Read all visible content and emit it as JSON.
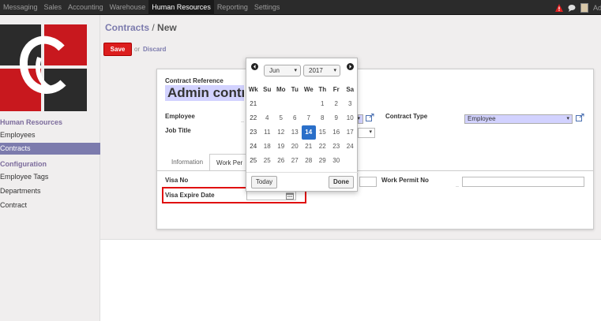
{
  "topbar": {
    "menu": [
      "Messaging",
      "Sales",
      "Accounting",
      "Warehouse",
      "Human Resources",
      "Reporting",
      "Settings"
    ],
    "active_index": 4,
    "user_name": "Adm"
  },
  "sidebar": {
    "sections": [
      {
        "title": "Human Resources",
        "items": [
          "Employees",
          "Contracts"
        ]
      },
      {
        "title": "Configuration",
        "items": [
          "Employee Tags",
          "Departments",
          "Contract"
        ]
      }
    ],
    "active_item": "Contracts"
  },
  "breadcrumb": {
    "parent": "Contracts",
    "separator": "/",
    "current": "New"
  },
  "actions": {
    "save": "Save",
    "or": "or",
    "discard": "Discard"
  },
  "form": {
    "contract_reference_label": "Contract Reference",
    "contract_reference_value": "Admin contr",
    "employee_label": "Employee",
    "job_title_label": "Job Title",
    "contract_type_label": "Contract Type",
    "contract_type_value": "Employee",
    "tabs": [
      "Information",
      "Work Per"
    ],
    "active_tab": 1,
    "visa_no_label": "Visa No",
    "work_permit_no_label": "Work Permit No",
    "visa_expire_label": "Visa Expire Date"
  },
  "datepicker": {
    "month": "Jun",
    "year": "2017",
    "headers": [
      "Wk",
      "Su",
      "Mo",
      "Tu",
      "We",
      "Th",
      "Fr",
      "Sa"
    ],
    "weeks": [
      [
        "21",
        "",
        "",
        "",
        "",
        "1",
        "2",
        "3"
      ],
      [
        "22",
        "4",
        "5",
        "6",
        "7",
        "8",
        "9",
        "10"
      ],
      [
        "23",
        "11",
        "12",
        "13",
        "14",
        "15",
        "16",
        "17"
      ],
      [
        "24",
        "18",
        "19",
        "20",
        "21",
        "22",
        "23",
        "24"
      ],
      [
        "25",
        "25",
        "26",
        "27",
        "28",
        "29",
        "30",
        ""
      ]
    ],
    "selected_day": "14",
    "today_label": "Today",
    "done_label": "Done"
  },
  "colors": {
    "accent": "#7c7bad",
    "save": "#dc1e1e",
    "selected": "#2a6fc9",
    "highlight": "#e01010"
  }
}
